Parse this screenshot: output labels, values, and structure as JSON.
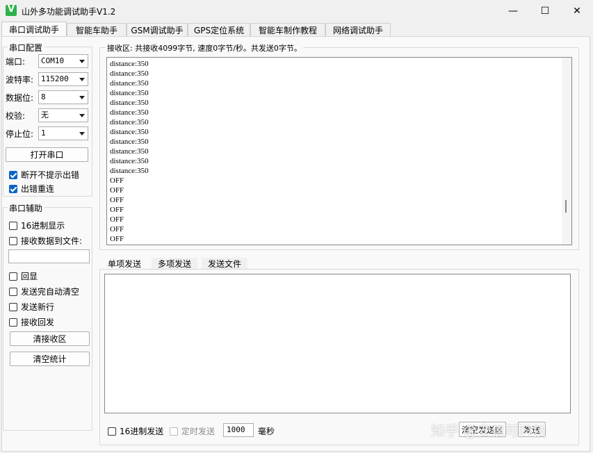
{
  "window": {
    "title": "山外多功能调试助手V1.2",
    "icon_letter": "V",
    "minimize": "—",
    "maximize": "☐",
    "close": "✕"
  },
  "tabs": [
    "串口调试助手",
    "智能车助手",
    "GSM调试助手",
    "GPS定位系统",
    "智能车制作教程",
    "网络调试助手"
  ],
  "serial_config": {
    "title": "串口配置",
    "port_label": "端口:",
    "port_value": "COM10",
    "baud_label": "波特率:",
    "baud_value": "115200",
    "databits_label": "数据位:",
    "databits_value": "8",
    "parity_label": "校验:",
    "parity_value": "无",
    "stopbits_label": "停止位:",
    "stopbits_value": "1",
    "open_button": "打开串口",
    "no_error_prompt": "断开不提示出错",
    "reconnect": "出错重连"
  },
  "serial_assist": {
    "title": "串口辅助",
    "hex_display": "16进制显示",
    "save_to_file": "接收数据到文件:",
    "echo": "回显",
    "auto_clear": "发送完自动清空",
    "send_newline": "发送新行",
    "recv_reply": "接收回发",
    "clear_recv": "清接收区",
    "clear_stats": "清空统计"
  },
  "receive": {
    "status": "接收区: 共接收4099字节, 速度0字节/秒。共发送0字节。",
    "lines": [
      "distance:350",
      "distance:350",
      "distance:350",
      "distance:350",
      "distance:350",
      "distance:350",
      "distance:350",
      "distance:350",
      "distance:350",
      "distance:350",
      "distance:350",
      "distance:350",
      "OFF",
      "OFF",
      "OFF",
      "OFF",
      "OFF",
      "OFF",
      "OFF"
    ]
  },
  "send": {
    "tabs": [
      "单项发送",
      "多项发送",
      "发送文件"
    ],
    "hex_send": "16进制发送",
    "timed_send": "定时发送",
    "interval": "1000",
    "unit": "毫秒",
    "clear_send": "清空发送区",
    "send_button": "发送"
  },
  "watermark": "知乎 @安信可科技"
}
